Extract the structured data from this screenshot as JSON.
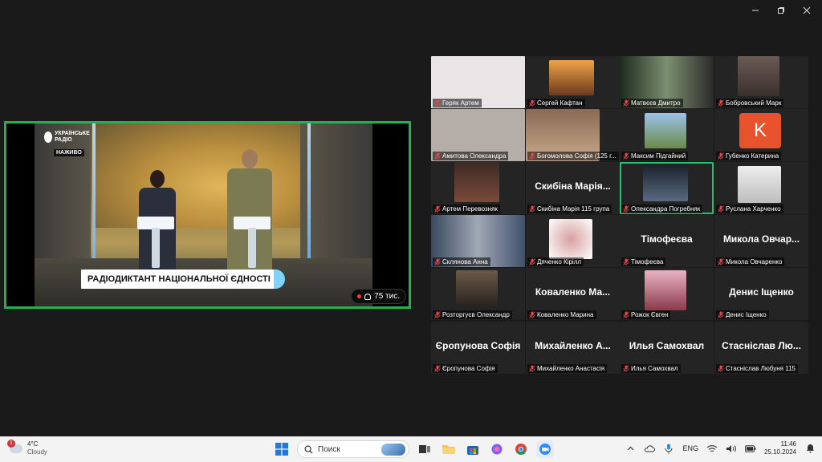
{
  "window": {
    "controls": {
      "minimize": "minimize",
      "restore": "restore",
      "close": "close"
    }
  },
  "main_video": {
    "logo_line1": "УКРАЇНСЬКЕ",
    "logo_line2": "РАДІО",
    "live_badge": "НАЖИВО",
    "title": "РАДІОДИКТАНТ НАЦІОНАЛЬНОЇ ЄДНОСТІ",
    "viewers": "75 тис."
  },
  "participants": [
    {
      "name": "Геряк Артем",
      "big": "",
      "active": false
    },
    {
      "name": "Сергей Кафтан",
      "big": "",
      "active": false
    },
    {
      "name": "Матвєєв Дмитро",
      "big": "",
      "active": false
    },
    {
      "name": "Бобровський Марк",
      "big": "",
      "active": false
    },
    {
      "name": "Амитова Олександра",
      "big": "",
      "active": false
    },
    {
      "name": "Богомолова Софія (125 г...",
      "big": "",
      "active": false
    },
    {
      "name": "Максим Підгайний",
      "big": "",
      "active": false
    },
    {
      "name": "Губенко Катерина",
      "big": "",
      "active": false,
      "avatar_letter": "K"
    },
    {
      "name": "Артем Перевозняк",
      "big": "",
      "active": false
    },
    {
      "name": "Скибіна Марія 115 група",
      "big": "Скибіна Марія...",
      "active": false
    },
    {
      "name": "Олександра Погребняк",
      "big": "",
      "active": true
    },
    {
      "name": "Руслана Харченко",
      "big": "",
      "active": false
    },
    {
      "name": "Склянова Анна",
      "big": "",
      "active": false
    },
    {
      "name": "Дяченко Кірілл",
      "big": "",
      "active": false
    },
    {
      "name": "Тімофеєва",
      "big": "Тімофеєва",
      "active": false
    },
    {
      "name": "Микола Овчаренко",
      "big": "Микола Овчар...",
      "active": false
    },
    {
      "name": "Розторгуєв Олександр",
      "big": "",
      "active": false
    },
    {
      "name": "Коваленко Марина",
      "big": "Коваленко Ма...",
      "active": false
    },
    {
      "name": "Рожок Євген",
      "big": "",
      "active": false
    },
    {
      "name": "Денис Іщенко",
      "big": "Денис Іщенко",
      "active": false
    },
    {
      "name": "Єропунова Софія",
      "big": "Єропунова Софія",
      "active": false
    },
    {
      "name": "Михайленко Анастасія",
      "big": "Михайленко А...",
      "active": false
    },
    {
      "name": "Илья Самохвал",
      "big": "Илья Самохвал",
      "active": false
    },
    {
      "name": "Стасніслав Любуня 115",
      "big": "Стасніслав Лю...",
      "active": false
    }
  ],
  "taskbar": {
    "weather_temp": "4°C",
    "weather_desc": "Cloudy",
    "weather_badge": "1",
    "search_placeholder": "Поиск",
    "lang": "ENG",
    "time": "11:46",
    "date": "25.10.2024"
  },
  "colors": {
    "active_border": "#22b14c",
    "muted_red": "#e5484d",
    "banner_accent": "#7fd3ff",
    "avatar_orange": "#e8532e"
  }
}
